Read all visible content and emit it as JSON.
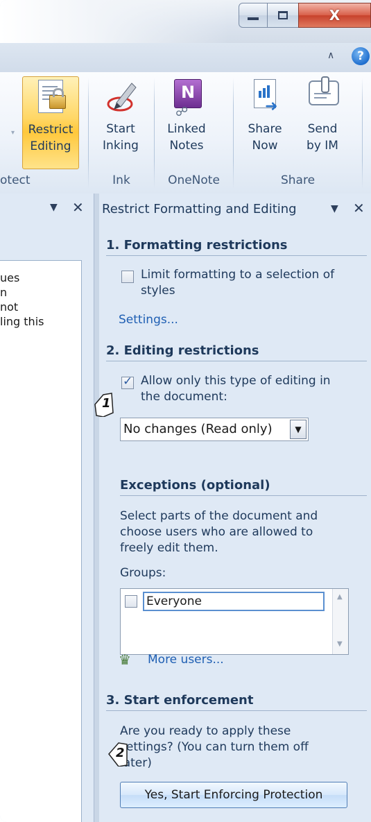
{
  "window": {
    "minimize_glyph": "minimize-icon",
    "maximize_glyph": "restore-icon",
    "close_glyph": "X",
    "help_glyph": "?"
  },
  "ribbon": {
    "buttons": [
      {
        "label": "Restrict\nEditing",
        "icon": "restrict-editing-icon",
        "active": true
      },
      {
        "label": "Start\nInking",
        "icon": "pen-icon"
      },
      {
        "label": "Linked\nNotes",
        "icon": "onenote-icon"
      },
      {
        "label": "Share\nNow",
        "icon": "share-icon"
      },
      {
        "label": "Send\nby IM",
        "icon": "im-icon"
      }
    ],
    "groups": [
      "otect",
      "Ink",
      "OneNote",
      "Share"
    ]
  },
  "left_pane": {
    "text_lines": [
      "ues",
      "n",
      "not",
      "ling this"
    ]
  },
  "right_pane": {
    "title": "Restrict Formatting and Editing",
    "section1": {
      "heading": "1. Formatting restrictions",
      "checkbox_label": "Limit formatting to a selection of\nstyles",
      "checked": false,
      "settings_link": "Settings..."
    },
    "section2": {
      "heading": "2. Editing restrictions",
      "checkbox_label": "Allow only this type of editing in\nthe document:",
      "checked": true,
      "select_value": "No changes (Read only)"
    },
    "exceptions": {
      "heading": "Exceptions (optional)",
      "description": "Select parts of the document and\nchoose users who are allowed to\nfreely edit them.",
      "groups_label": "Groups:",
      "group_item": "Everyone",
      "more_users_link": "More users..."
    },
    "section3": {
      "heading": "3. Start enforcement",
      "description": "Are you ready to apply these\nsettings? (You can turn them off\nlater)",
      "enforce_button": "Yes, Start Enforcing Protection"
    },
    "callouts": [
      "1",
      "2"
    ]
  },
  "colors": {
    "ribbon_active": "#ffd766",
    "pane_bg": "#dfe9f5",
    "link": "#1f5fb3",
    "close_red": "#c7412c"
  }
}
